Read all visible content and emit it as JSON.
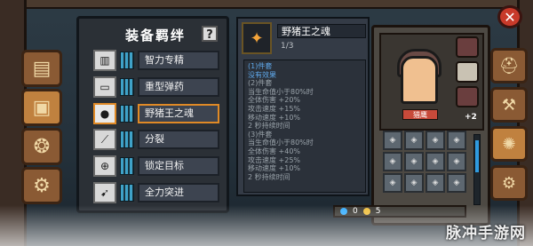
{
  "bond_panel": {
    "title": "装备羁绊",
    "help": "?",
    "items": [
      {
        "icon": "book-icon",
        "label": "智力专精",
        "selected": false
      },
      {
        "icon": "ammo-icon",
        "label": "重型弹药",
        "selected": false
      },
      {
        "icon": "boar-soul-icon",
        "label": "野猪王之魂",
        "selected": true
      },
      {
        "icon": "split-icon",
        "label": "分裂",
        "selected": false
      },
      {
        "icon": "target-icon",
        "label": "锁定目标",
        "selected": false
      },
      {
        "icon": "charge-icon",
        "label": "全力突进",
        "selected": false
      }
    ]
  },
  "tooltip": {
    "name": "野猪王之魂",
    "count": "1/3",
    "lines": [
      {
        "text": "(1)件套",
        "style": "blue"
      },
      {
        "text": "没有效果",
        "style": "blue"
      },
      {
        "text": "(2)件套",
        "style": "dim"
      },
      {
        "text": "当生命值小于80%时",
        "style": "dim"
      },
      {
        "text": "全体伤害 +20%",
        "style": "dim"
      },
      {
        "text": "攻击速度 +15%",
        "style": "dim"
      },
      {
        "text": "移动速度 +10%",
        "style": "dim"
      },
      {
        "text": "2 秒持续时间",
        "style": "dim"
      },
      {
        "text": "(3)件套",
        "style": "dim"
      },
      {
        "text": "当生命值小于80%时",
        "style": "dim"
      },
      {
        "text": "全体伤害 +40%",
        "style": "dim"
      },
      {
        "text": "攻击速度 +25%",
        "style": "dim"
      },
      {
        "text": "移动速度 +10%",
        "style": "dim"
      },
      {
        "text": "2 秒持续时间",
        "style": "dim"
      }
    ]
  },
  "character": {
    "label": "猎鹰",
    "upgrade": "+2"
  },
  "bottom_bar": {
    "currency_a": "0",
    "currency_b": "5"
  },
  "watermark": "脉冲手游网",
  "close_label": "✕"
}
